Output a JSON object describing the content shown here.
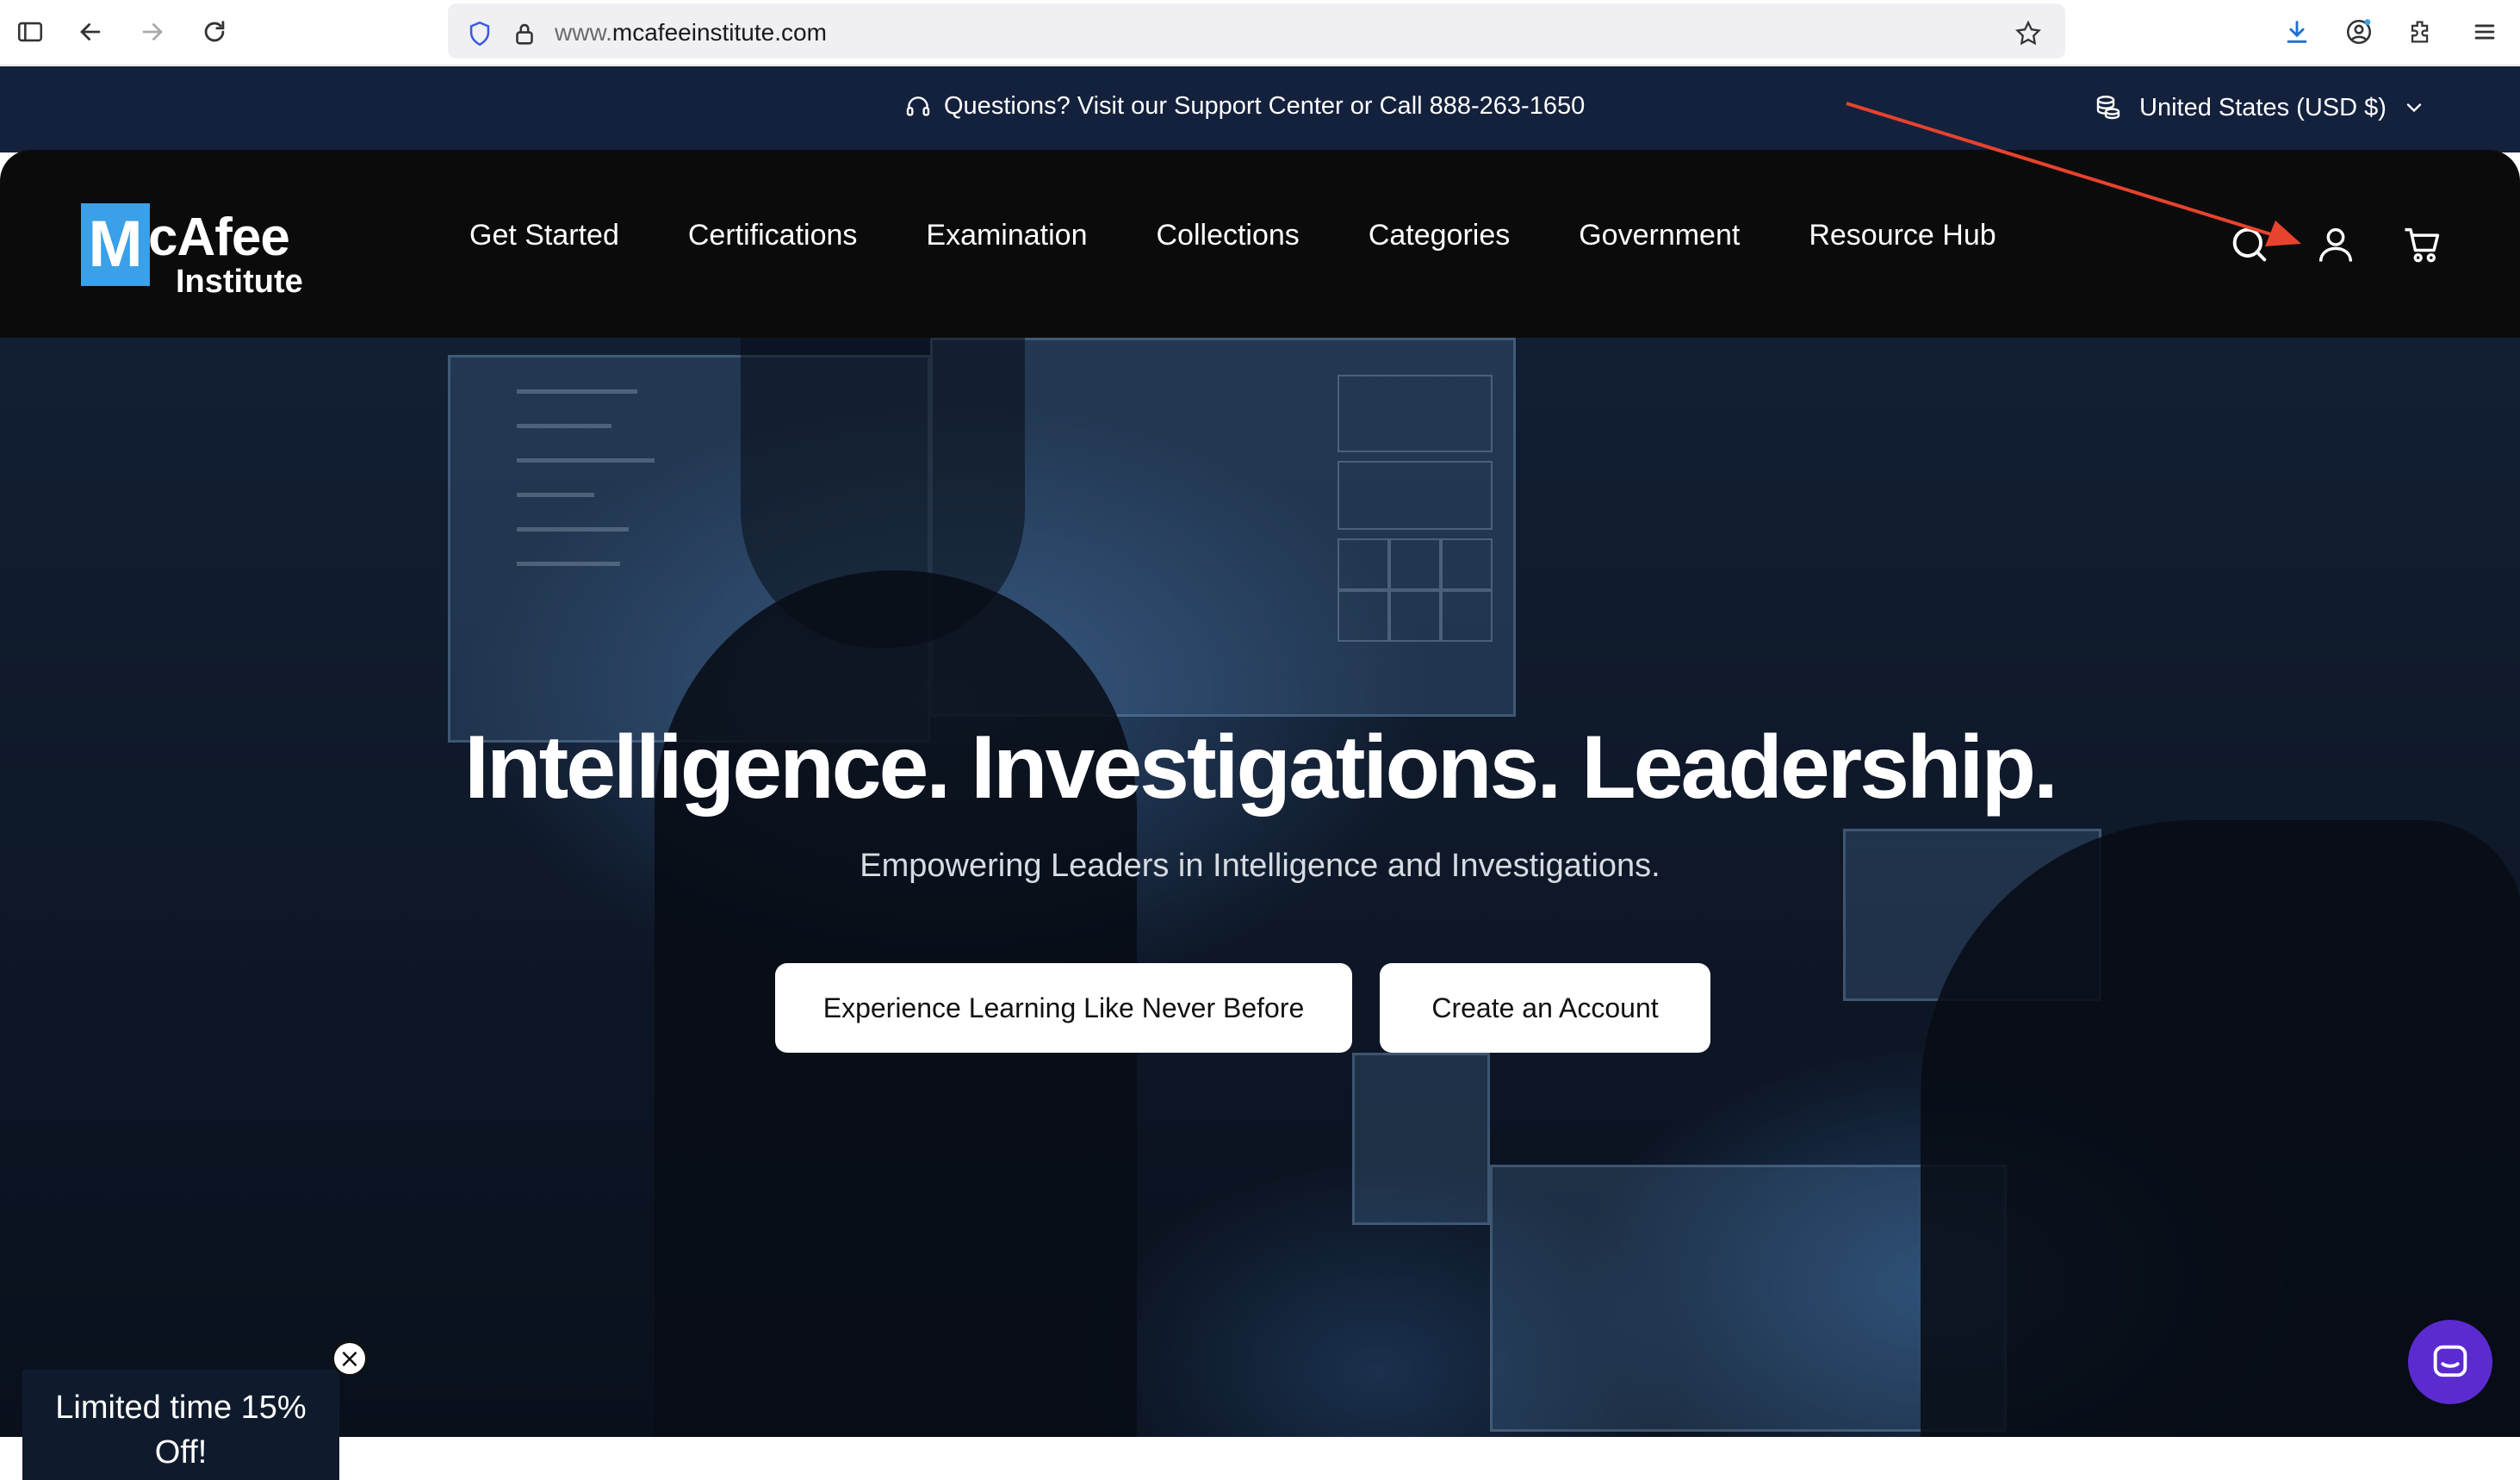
{
  "browser": {
    "url_prefix": "www.",
    "url_domain": "mcafeeinstitute.com"
  },
  "announcement": {
    "message": "Questions? Visit our Support Center or Call 888-263-1650",
    "currency": "United States (USD $)"
  },
  "logo": {
    "box_letter": "M",
    "rest": "cAfee",
    "sub": "Institute"
  },
  "nav": {
    "items": [
      "Get Started",
      "Certifications",
      "Examination",
      "Collections",
      "Categories",
      "Government",
      "Resource Hub"
    ]
  },
  "hero": {
    "title": "Intelligence. Investigations. Leadership.",
    "subtitle": "Empowering Leaders in Intelligence and Investigations.",
    "primary_button": "Experience Learning Like Never Before",
    "secondary_button": "Create an Account"
  },
  "promo": {
    "text_line1": "Limited time 15%",
    "text_line2": "Off!",
    "close_glyph": "×"
  },
  "colors": {
    "announcement_bg": "#14213d",
    "header_bg": "#0b0b0c",
    "logo_blue": "#3aa0e8",
    "annotation_arrow": "#e8432e",
    "chat_purple": "#5b2bd0"
  }
}
